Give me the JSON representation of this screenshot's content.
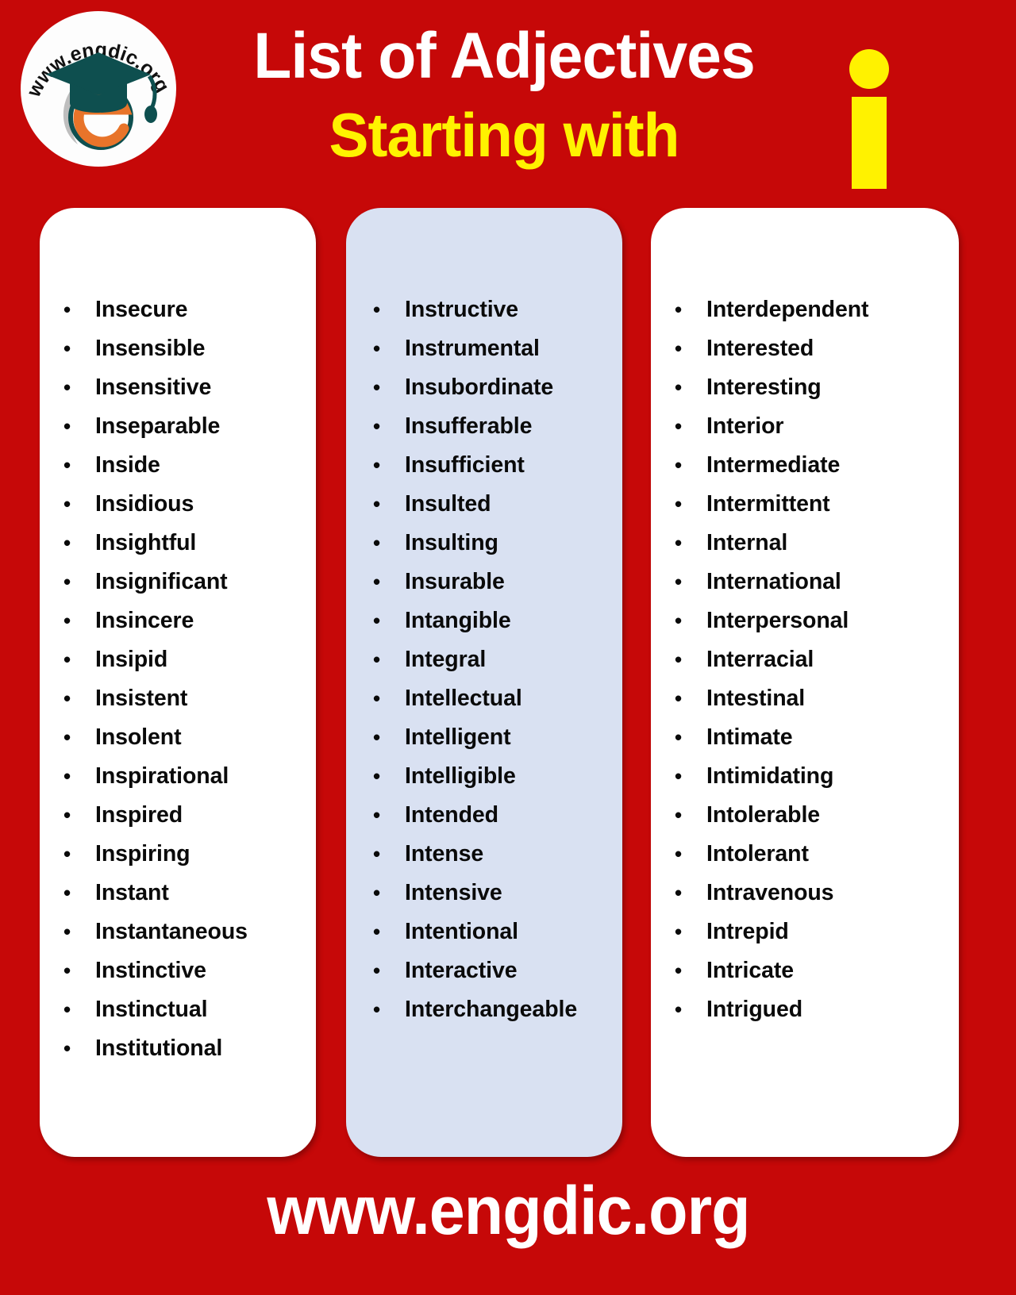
{
  "page": {
    "background_color": "#C60808",
    "accent_yellow": "#FFF200",
    "card_white": "#FFFFFF",
    "card_blue": "#D9E1F2",
    "text_color": "#0A0A0A"
  },
  "header": {
    "title_main": "List of Adjectives",
    "title_sub": "Starting with",
    "letter": "i",
    "logo": {
      "brand_text": "www.engdic.org",
      "cap_color": "#0E4F4F",
      "e_color": "#E8742A"
    }
  },
  "columns": [
    {
      "id": "column-1",
      "background": "#FFFFFF",
      "items": [
        "Insecure",
        "Insensible",
        "Insensitive",
        "Inseparable",
        "Inside",
        "Insidious",
        "Insightful",
        "Insignificant",
        "Insincere",
        "Insipid",
        "Insistent",
        "Insolent",
        "Inspirational",
        "Inspired",
        "Inspiring",
        "Instant",
        "Instantaneous",
        "Instinctive",
        "Instinctual",
        "Institutional"
      ]
    },
    {
      "id": "column-2",
      "background": "#D9E1F2",
      "items": [
        "Instructive",
        "Instrumental",
        "Insubordinate",
        "Insufferable",
        "Insufficient",
        "Insulted",
        "Insulting",
        "Insurable",
        "Intangible",
        "Integral",
        "Intellectual",
        "Intelligent",
        "Intelligible",
        "Intended",
        "Intense",
        "Intensive",
        "Intentional",
        "Interactive",
        "Interchangeable"
      ]
    },
    {
      "id": "column-3",
      "background": "#FFFFFF",
      "items": [
        "Interdependent",
        "Interested",
        "Interesting",
        "Interior",
        "Intermediate",
        "Intermittent",
        "Internal",
        "International",
        "Interpersonal",
        "Interracial",
        "Intestinal",
        "Intimate",
        "Intimidating",
        "Intolerable",
        "Intolerant",
        "Intravenous",
        "Intrepid",
        "Intricate",
        "Intrigued"
      ]
    }
  ],
  "footer": {
    "url": "www.engdic.org"
  },
  "bullet_glyph": "•"
}
